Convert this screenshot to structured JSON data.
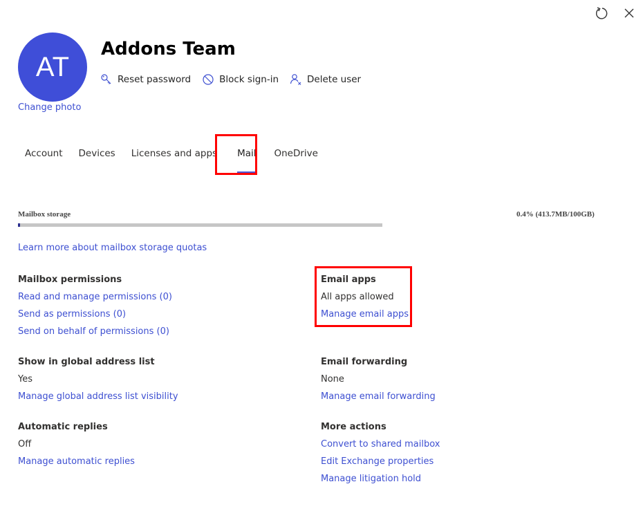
{
  "window": {
    "refresh_icon": "refresh-icon",
    "close_icon": "close-icon"
  },
  "user": {
    "initials": "AT",
    "avatar_color": "#3f4ed8",
    "change_photo_label": "Change photo",
    "display_name": "Addons Team"
  },
  "actions": [
    {
      "label": "Reset password",
      "icon": "key-icon"
    },
    {
      "label": "Block sign-in",
      "icon": "block-icon"
    },
    {
      "label": "Delete user",
      "icon": "delete-user-icon"
    }
  ],
  "tabs": [
    {
      "label": "Account",
      "active": false
    },
    {
      "label": "Devices",
      "active": false
    },
    {
      "label": "Licenses and apps",
      "active": false
    },
    {
      "label": "Mail",
      "active": true
    },
    {
      "label": "OneDrive",
      "active": false
    }
  ],
  "storage": {
    "label": "Mailbox storage",
    "usage_text": "0.4% (413.7MB/100GB)",
    "percent_used": 0.4,
    "learn_more_label": "Learn more about mailbox storage quotas"
  },
  "sections": {
    "mailbox_permissions": {
      "heading": "Mailbox permissions",
      "links": [
        "Read and manage permissions (0)",
        "Send as permissions (0)",
        "Send on behalf of permissions (0)"
      ]
    },
    "email_apps": {
      "heading": "Email apps",
      "value": "All apps allowed",
      "link": "Manage email apps"
    },
    "global_address_list": {
      "heading": "Show in global address list",
      "value": "Yes",
      "link": "Manage global address list visibility"
    },
    "email_forwarding": {
      "heading": "Email forwarding",
      "value": "None",
      "link": "Manage email forwarding"
    },
    "automatic_replies": {
      "heading": "Automatic replies",
      "value": "Off",
      "link": "Manage automatic replies"
    },
    "more_actions": {
      "heading": "More actions",
      "links": [
        "Convert to shared mailbox",
        "Edit Exchange properties",
        "Manage litigation hold"
      ]
    }
  },
  "colors": {
    "link": "#3d4fd1",
    "accent": "#4a57d6",
    "highlight_box": "#ff0000",
    "storage_bar_track": "#c6c6c6",
    "storage_bar_fill": "#2b2f8f"
  }
}
